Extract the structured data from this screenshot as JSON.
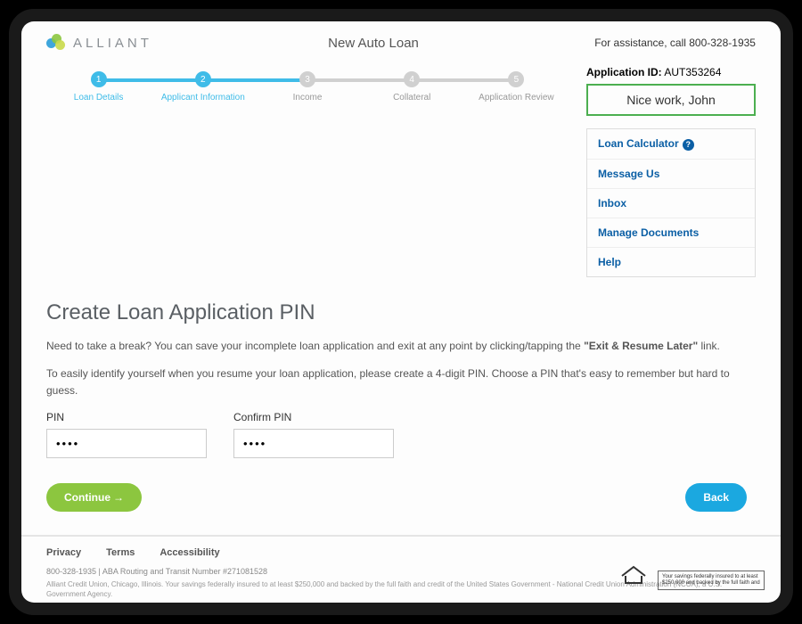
{
  "header": {
    "brand": "ALLIANT",
    "title": "New Auto Loan",
    "assistance": "For assistance, call 800-328-1935"
  },
  "steps": [
    {
      "num": "1",
      "label": "Loan Details",
      "active": true
    },
    {
      "num": "2",
      "label": "Applicant Information",
      "active": true
    },
    {
      "num": "3",
      "label": "Income",
      "active": false
    },
    {
      "num": "4",
      "label": "Collateral",
      "active": false
    },
    {
      "num": "5",
      "label": "Application Review",
      "active": false
    }
  ],
  "right": {
    "appid_label": "Application ID:",
    "appid_value": "AUT353264",
    "nice": "Nice work, John",
    "links": {
      "calc": "Loan Calculator",
      "msg": "Message Us",
      "inbox": "Inbox",
      "docs": "Manage Documents",
      "help": "Help"
    }
  },
  "content": {
    "heading": "Create Loan Application PIN",
    "p1a": "Need to take a break? You can save your incomplete loan application and exit at any point by clicking/tapping the ",
    "p1b": "\"Exit & Resume Later\"",
    "p1c": " link.",
    "p2": "To easily identify yourself when you resume your loan application, please create a 4-digit PIN. Choose a PIN that's easy to remember but hard to guess.",
    "pin_label": "PIN",
    "confirm_label": "Confirm PIN",
    "pin_value": "••••",
    "confirm_value": "••••",
    "continue": "Continue",
    "back": "Back"
  },
  "footer": {
    "privacy": "Privacy",
    "terms": "Terms",
    "access": "Accessibility",
    "meta": "800-328-1935 | ABA Routing and Transit Number #271081528",
    "disc": "Alliant Credit Union, Chicago, Illinois. Your savings federally insured to at least $250,000 and backed by the full faith and credit of the United States Government - National Credit Union Administration (NCUA), a U.S. Government Agency.",
    "insured": "Your savings federally insured to at least $250,000 and backed by the full faith and"
  }
}
